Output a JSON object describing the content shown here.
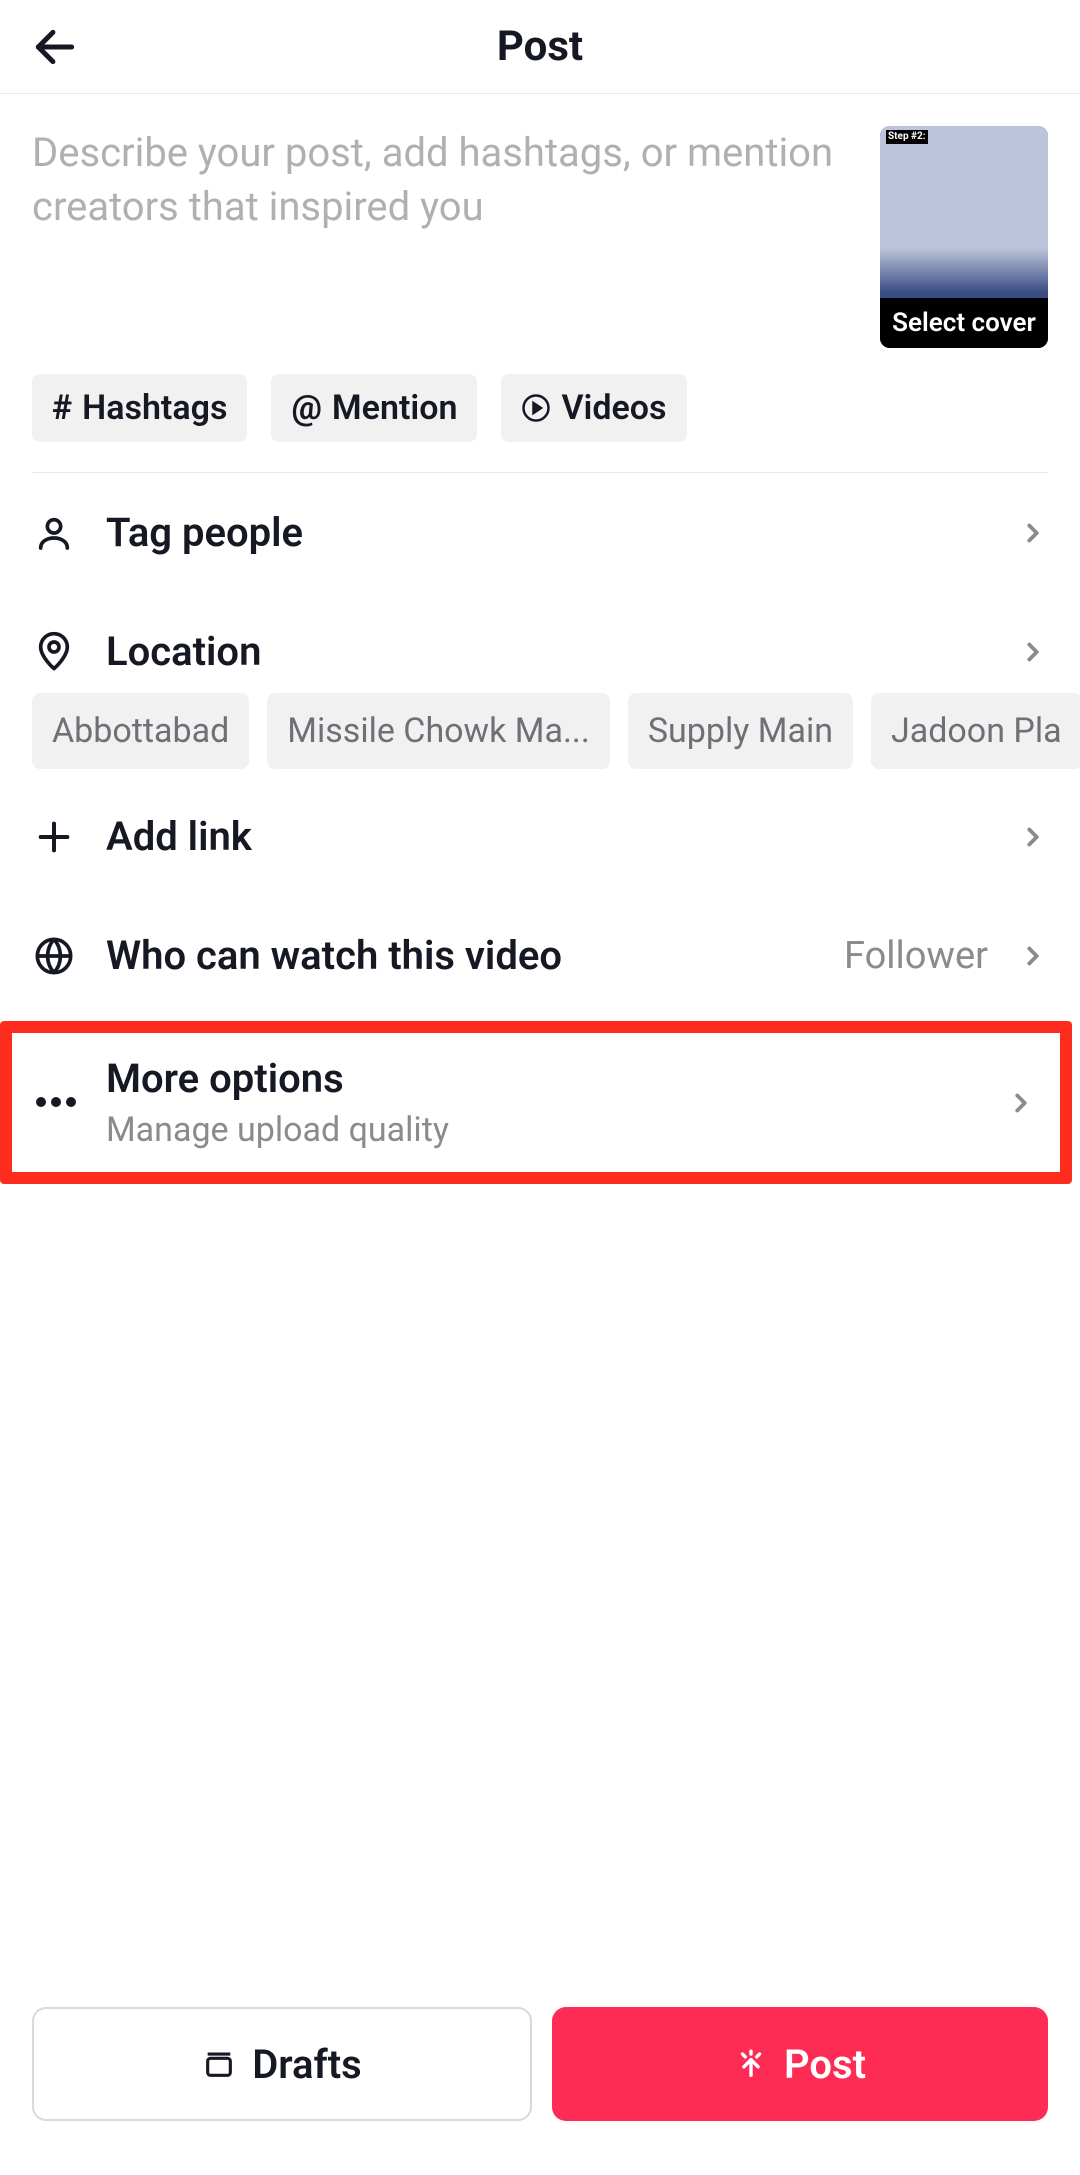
{
  "header": {
    "title": "Post"
  },
  "compose": {
    "placeholder": "Describe your post, add hashtags, or mention creators that inspired you",
    "cover_label": "Select cover"
  },
  "chips": {
    "hashtags": "Hashtags",
    "mention": "Mention",
    "videos": "Videos"
  },
  "rows": {
    "tag_people": "Tag people",
    "location": "Location",
    "add_link": "Add link",
    "privacy_label": "Who can watch this video",
    "privacy_value": "Follower",
    "more_title": "More options",
    "more_sub": "Manage upload quality"
  },
  "locations": [
    "Abbottabad",
    "Missile Chowk Ma...",
    "Supply Main",
    "Jadoon Pla"
  ],
  "buttons": {
    "drafts": "Drafts",
    "post": "Post"
  }
}
